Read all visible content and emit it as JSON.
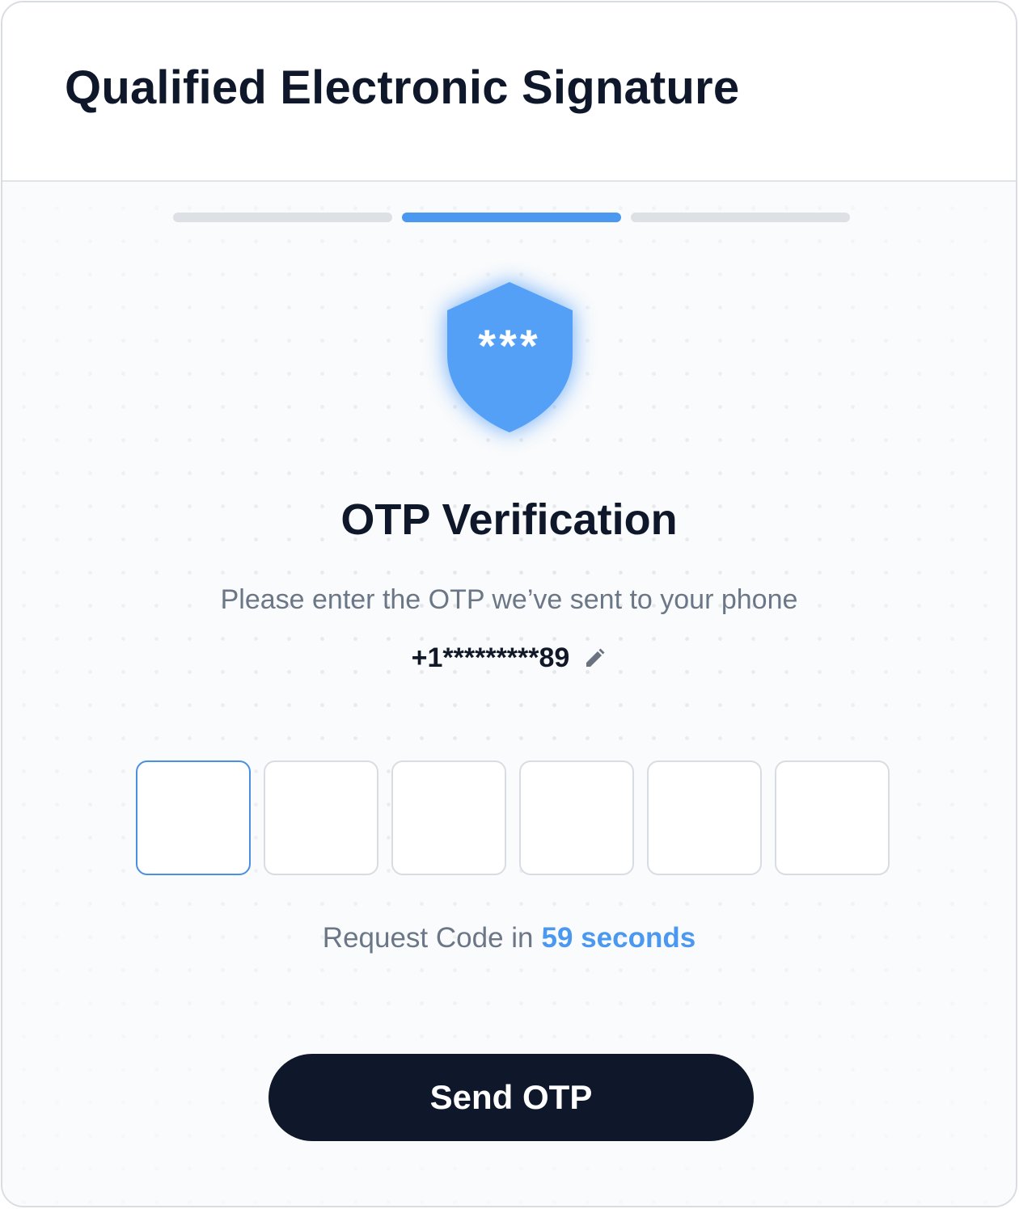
{
  "header": {
    "title": "Qualified Electronic Signature"
  },
  "progress": {
    "total_steps": 3,
    "current_step": 2
  },
  "shield": {
    "icon": "shield-asterisk-icon",
    "glyph": "***",
    "color": "#55a0f7"
  },
  "verification": {
    "title": "OTP Verification",
    "subtitle": "Please enter the OTP we’ve sent to your phone",
    "phone": "+1*********89",
    "edit_icon": "pencil-icon"
  },
  "otp": {
    "digits": [
      "",
      "",
      "",
      "",
      "",
      ""
    ],
    "focused_index": 0
  },
  "timer": {
    "label": "Request Code in",
    "countdown": "59 seconds"
  },
  "actions": {
    "send_label": "Send OTP"
  },
  "colors": {
    "accent": "#4a98f0",
    "dark": "#0f172a",
    "muted_text": "#6b7787"
  }
}
